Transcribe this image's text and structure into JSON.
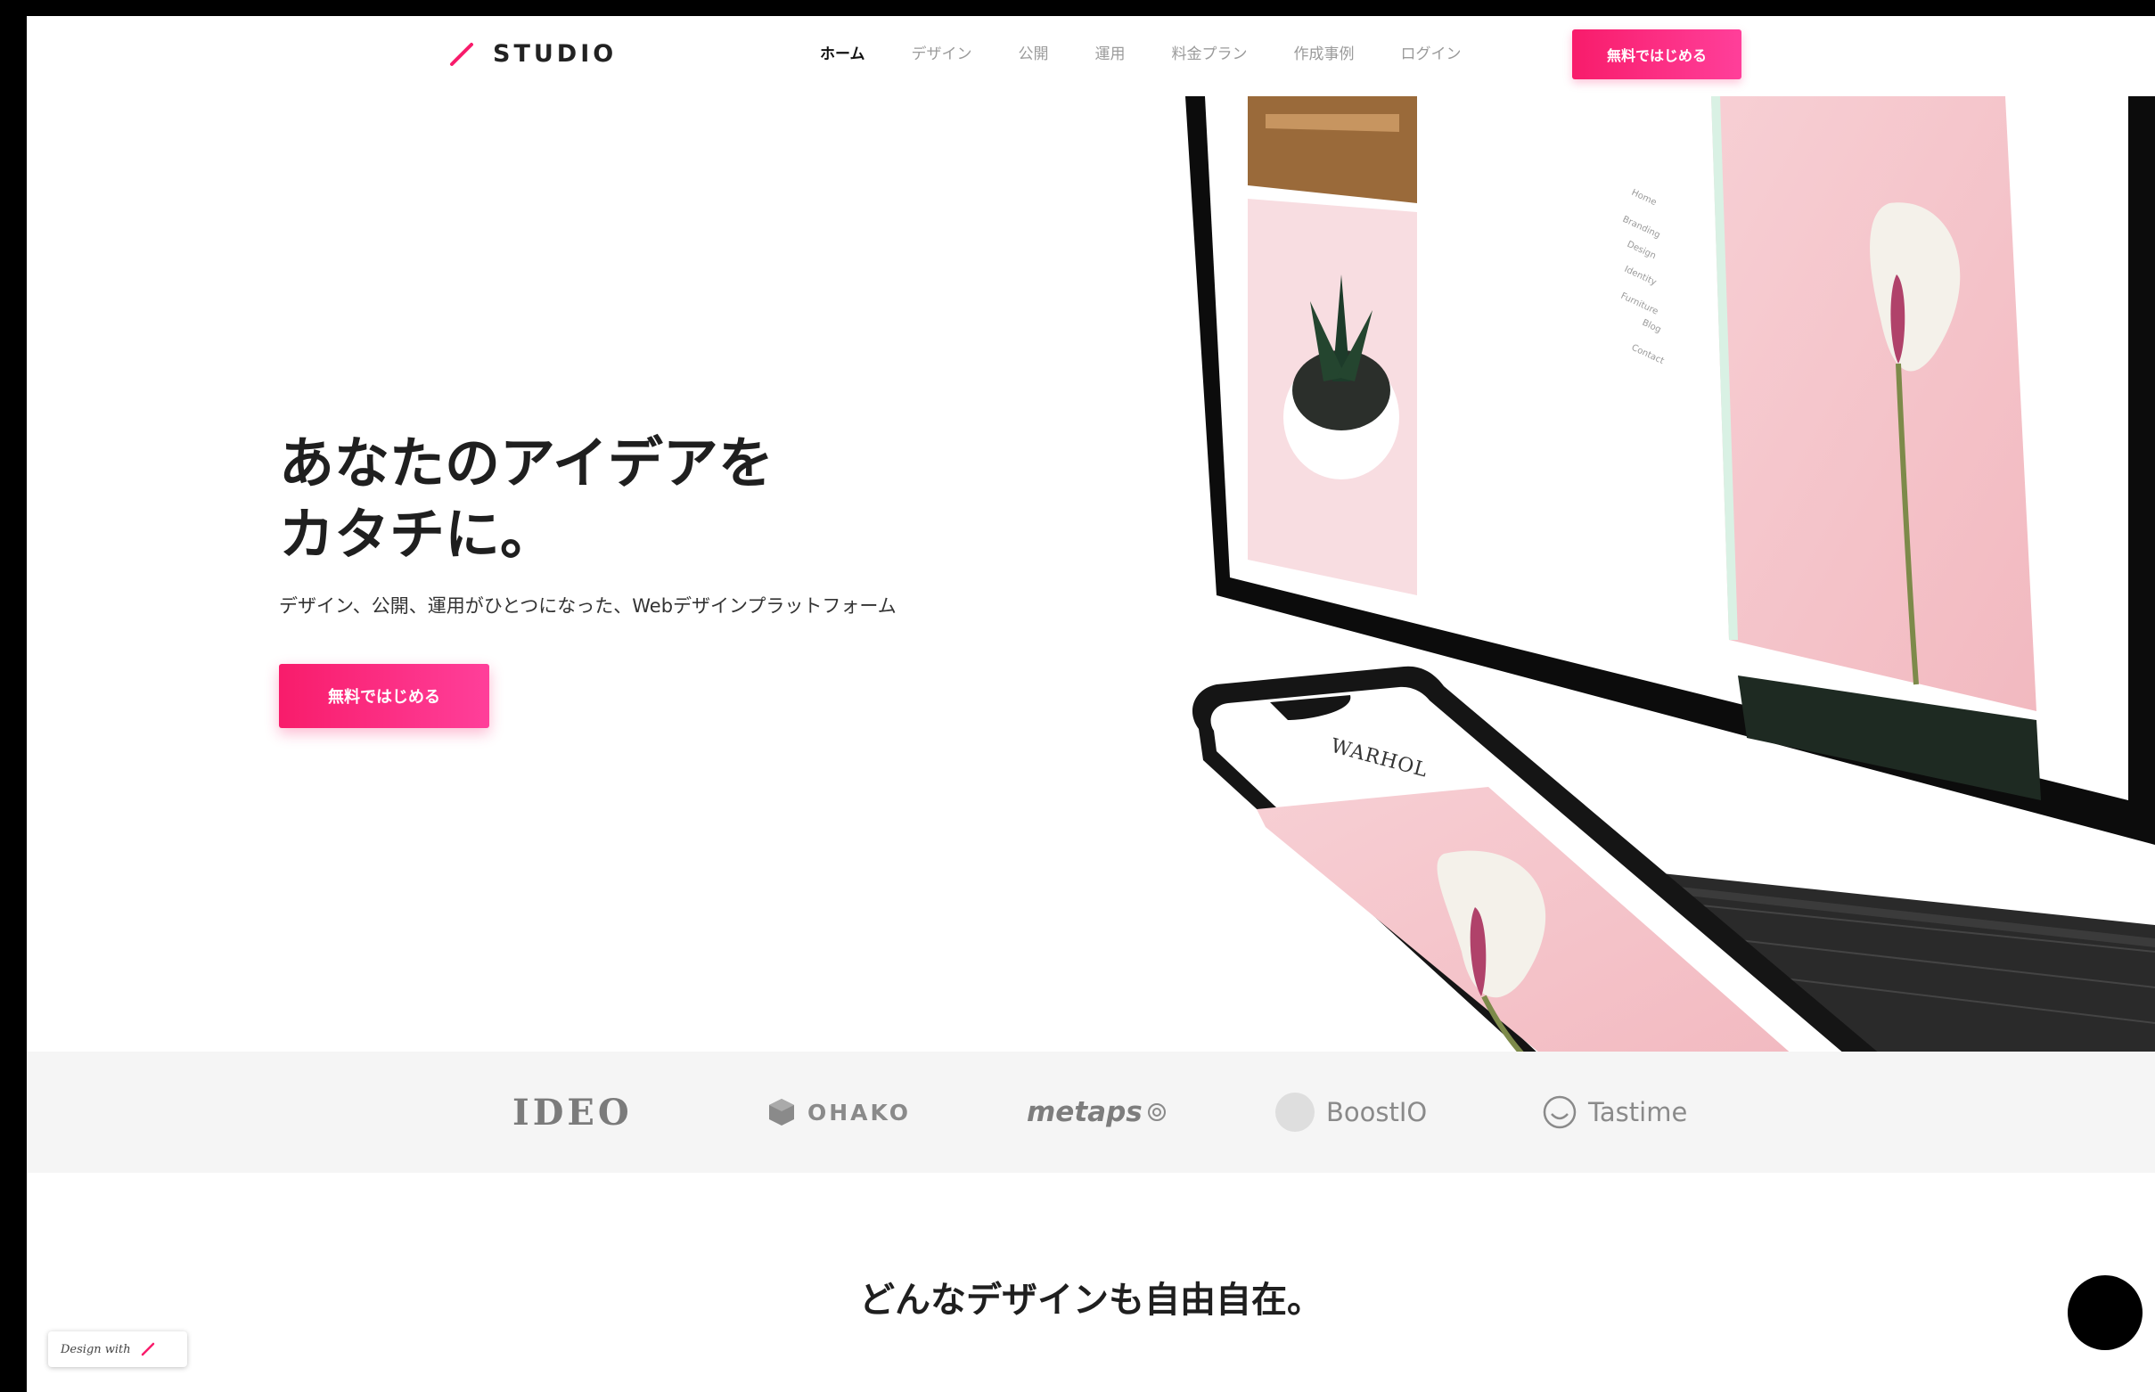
{
  "header": {
    "logo_text": "STUDIO",
    "nav": [
      {
        "label": "ホーム",
        "active": true
      },
      {
        "label": "デザイン",
        "active": false
      },
      {
        "label": "公開",
        "active": false
      },
      {
        "label": "運用",
        "active": false
      },
      {
        "label": "料金プラン",
        "active": false
      },
      {
        "label": "作成事例",
        "active": false
      },
      {
        "label": "ログイン",
        "active": false
      }
    ],
    "cta_label": "無料ではじめる"
  },
  "hero": {
    "title_line1": "あなたのアイデアを",
    "title_line2": "カタチに。",
    "subtitle": "デザイン、公開、運用がひとつになった、Webデザインプラットフォーム",
    "cta_label": "無料ではじめる",
    "phone_brand": "WARHOL",
    "site_menu": [
      "Home",
      "Branding",
      "Design",
      "Identity",
      "Furniture",
      "Blog",
      "Contact"
    ]
  },
  "logos": [
    "IDEO",
    "OHAKO",
    "metaps",
    "BoostIO",
    "Tastime"
  ],
  "section": {
    "title": "どんなデザインも自由自在。"
  },
  "badge": {
    "label": "Design with"
  },
  "colors": {
    "accent": "#f81c6b",
    "accent_end": "#ff3f9a",
    "pink_bg": "#f6c6cc",
    "band_bg": "#f5f5f5"
  }
}
